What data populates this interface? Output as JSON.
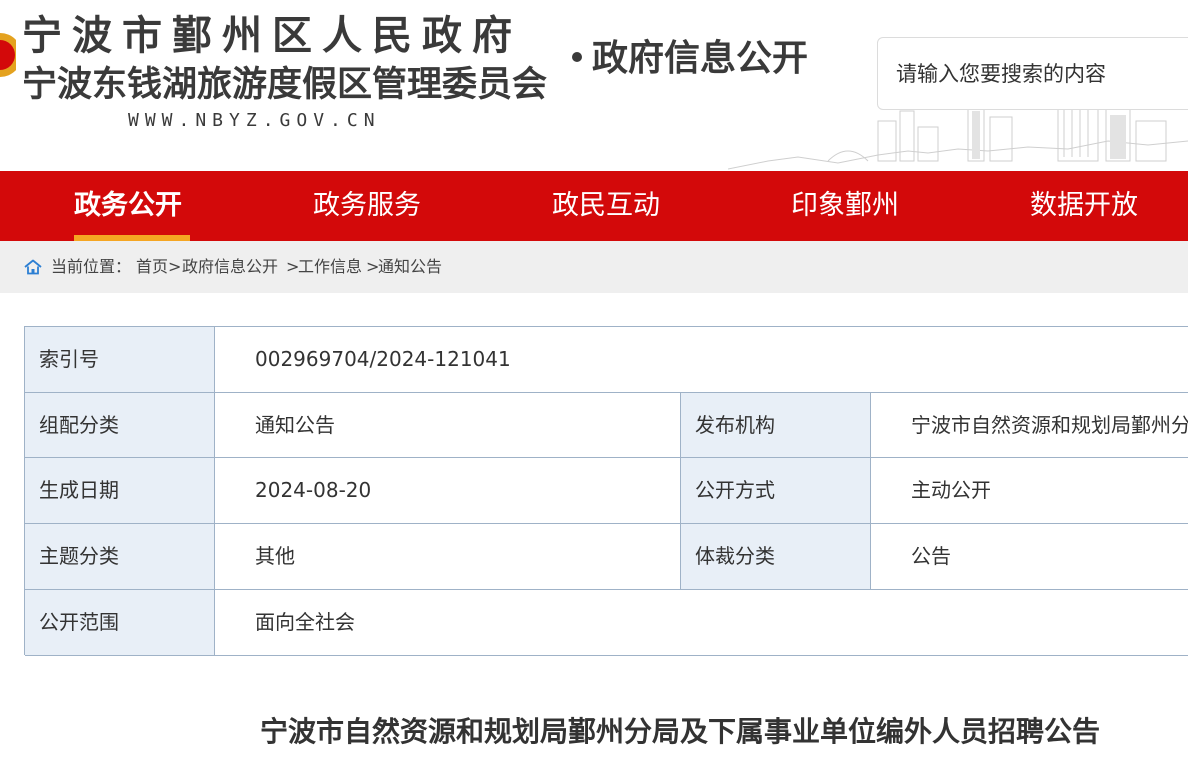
{
  "header": {
    "site_name_1": "宁波市鄞州区人民政府",
    "site_name_2": "宁波东钱湖旅游度假区管理委员会",
    "site_url": "WWW.NBYZ.GOV.CN",
    "section_name": "政府信息公开",
    "search_placeholder": "请输入您要搜索的内容"
  },
  "nav": {
    "items": [
      {
        "label": "政务公开",
        "active": true
      },
      {
        "label": "政务服务",
        "active": false
      },
      {
        "label": "政民互动",
        "active": false
      },
      {
        "label": "印象鄞州",
        "active": false
      },
      {
        "label": "数据开放",
        "active": false
      }
    ]
  },
  "breadcrumb": {
    "prefix": "当前位置：",
    "items": [
      "首页",
      "政府信息公开",
      "工作信息",
      "通知公告"
    ],
    "separator": ">"
  },
  "info_table": {
    "index_no": {
      "label": "索引号",
      "value": "002969704/2024-121041"
    },
    "category": {
      "label": "组配分类",
      "value": "通知公告"
    },
    "publisher": {
      "label": "发布机构",
      "value": "宁波市自然资源和规划局鄞州分局"
    },
    "date": {
      "label": "生成日期",
      "value": "2024-08-20"
    },
    "disclosure_method": {
      "label": "公开方式",
      "value": "主动公开"
    },
    "topic": {
      "label": "主题分类",
      "value": "其他"
    },
    "genre": {
      "label": "体裁分类",
      "value": "公告"
    },
    "scope": {
      "label": "公开范围",
      "value": "面向全社会"
    }
  },
  "article": {
    "title": "宁波市自然资源和规划局鄞州分局及下属事业单位编外人员招聘公告"
  },
  "colors": {
    "nav_bg": "#d3090a",
    "nav_active_underline": "#f5a623",
    "label_cell_bg": "#e8eff7",
    "table_border": "#9fb2c7"
  }
}
